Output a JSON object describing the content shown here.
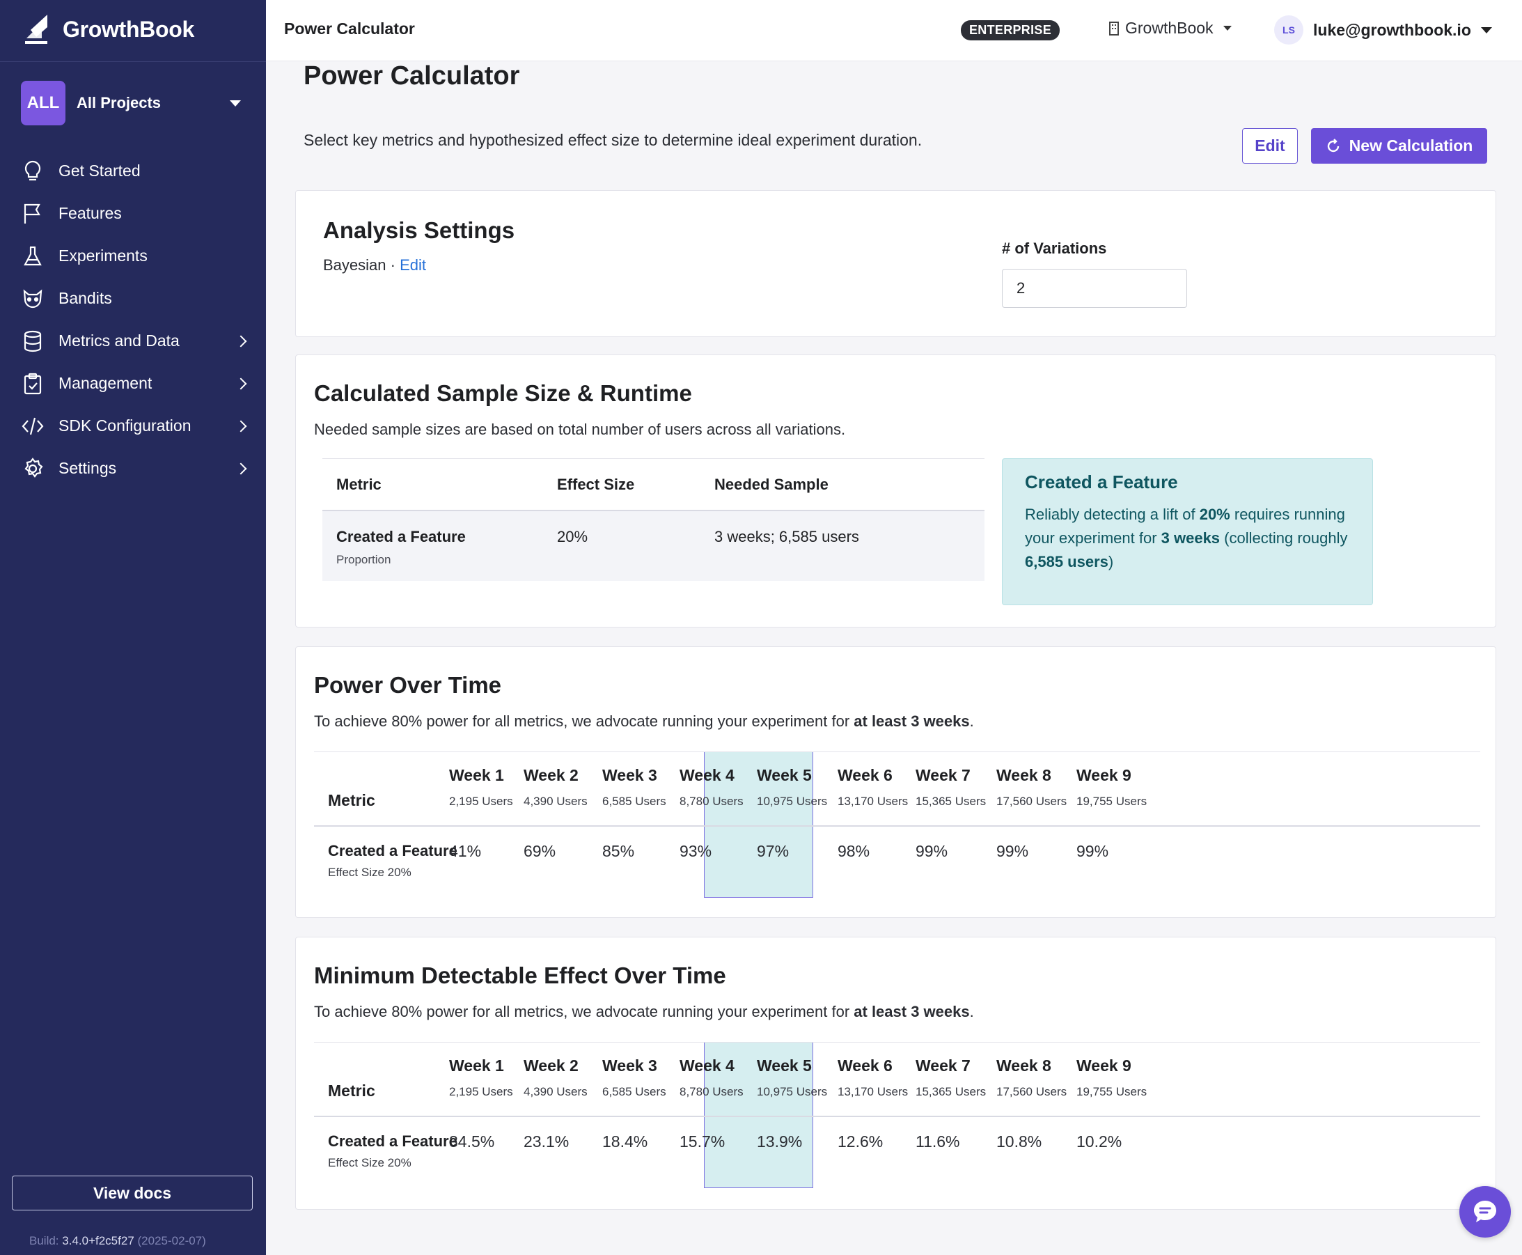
{
  "app": {
    "logo_text": "GrowthBook"
  },
  "sidebar": {
    "project_badge": "ALL",
    "project_name": "All Projects",
    "items": [
      {
        "label": "Get Started",
        "icon": "lightbulb-icon",
        "has_children": false
      },
      {
        "label": "Features",
        "icon": "flag-icon",
        "has_children": false
      },
      {
        "label": "Experiments",
        "icon": "flask-icon",
        "has_children": false
      },
      {
        "label": "Bandits",
        "icon": "raccoon-icon",
        "has_children": false
      },
      {
        "label": "Metrics and Data",
        "icon": "database-icon",
        "has_children": true
      },
      {
        "label": "Management",
        "icon": "clipboard-icon",
        "has_children": true
      },
      {
        "label": "SDK Configuration",
        "icon": "code-icon",
        "has_children": true
      },
      {
        "label": "Settings",
        "icon": "gear-icon",
        "has_children": true
      }
    ],
    "view_docs": "View docs",
    "build_label": "Build:",
    "build_version": "3.4.0+f2c5f27",
    "build_date": "(2025-02-07)"
  },
  "topbar": {
    "title": "Power Calculator",
    "badge": "ENTERPRISE",
    "org": "GrowthBook",
    "avatar_initials": "LS",
    "user_email": "luke@growthbook.io"
  },
  "main": {
    "title": "Power Calculator",
    "description": "Select key metrics and hypothesized effect size to determine ideal experiment duration.",
    "edit_button": "Edit",
    "new_calc_button": "New Calculation",
    "analysis": {
      "title": "Analysis Settings",
      "engine": "Bayesian",
      "separator": " · ",
      "edit_link": "Edit",
      "variations_label": "# of Variations",
      "variations_value": "2"
    },
    "sample": {
      "title": "Calculated Sample Size & Runtime",
      "subtitle": "Needed sample sizes are based on total number of users across all variations.",
      "headers": {
        "metric": "Metric",
        "effect": "Effect Size",
        "needed": "Needed Sample"
      },
      "row": {
        "metric": "Created a Feature",
        "metric_type": "Proportion",
        "effect": "20%",
        "needed": "3 weeks; 6,585 users"
      },
      "callout": {
        "title": "Created a Feature",
        "p1": "Reliably detecting a lift of ",
        "b1": "20%",
        "p2": " requires running your experiment for ",
        "b2": "3 weeks",
        "p3": " (collecting roughly ",
        "b3": "6,585 users",
        "p4": ")"
      }
    },
    "power": {
      "title": "Power Over Time",
      "sub_pre": "To achieve 80% power for all metrics, we advocate running your experiment for ",
      "sub_bold": "at least 3 weeks",
      "sub_post": ".",
      "metric_header": "Metric",
      "metric": "Created a Feature",
      "metric_sub": "Effect Size 20%",
      "values": [
        "41%",
        "69%",
        "85%",
        "93%",
        "97%",
        "98%",
        "99%",
        "99%",
        "99%"
      ]
    },
    "mde": {
      "title": "Minimum Detectable Effect Over Time",
      "sub_pre": "To achieve 80% power for all metrics, we advocate running your experiment for ",
      "sub_bold": "at least 3 weeks",
      "sub_post": ".",
      "metric_header": "Metric",
      "metric": "Created a Feature",
      "metric_sub": "Effect Size 20%",
      "values": [
        "34.5%",
        "23.1%",
        "18.4%",
        "15.7%",
        "13.9%",
        "12.6%",
        "11.6%",
        "10.8%",
        "10.2%"
      ]
    },
    "weeks": [
      {
        "name": "Week 1",
        "users": "2,195 Users"
      },
      {
        "name": "Week 2",
        "users": "4,390 Users"
      },
      {
        "name": "Week 3",
        "users": "6,585 Users"
      },
      {
        "name": "Week 4",
        "users": "8,780 Users"
      },
      {
        "name": "Week 5",
        "users": "10,975 Users"
      },
      {
        "name": "Week 6",
        "users": "13,170 Users"
      },
      {
        "name": "Week 7",
        "users": "15,365 Users"
      },
      {
        "name": "Week 8",
        "users": "17,560 Users"
      },
      {
        "name": "Week 9",
        "users": "19,755 Users"
      }
    ]
  },
  "colors": {
    "sidebar": "#252a5c",
    "accent": "#6a4ed8",
    "highlight": "#d6eef0",
    "link": "#2570d8"
  }
}
